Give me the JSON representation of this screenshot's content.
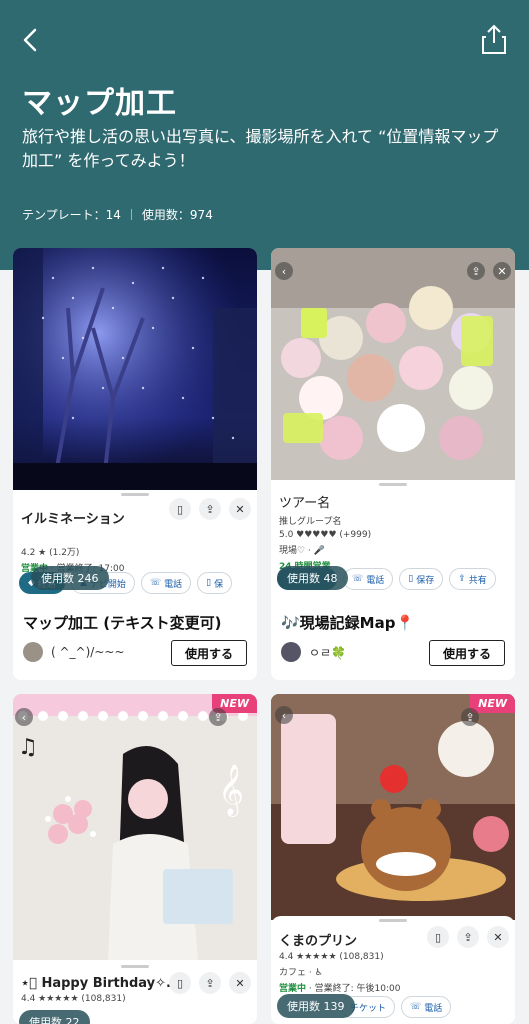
{
  "header": {
    "title": "マップ加工",
    "description": "旅行や推し活の思い出写真に、撮影場所を入れて “位置情報マップ加工” を作ってみよう！",
    "templates_label": "テンプレート：14",
    "usage_label": "使用数：974"
  },
  "cards": [
    {
      "place_name": "イルミネーション",
      "rating": "4.2 ★ (1.2万)",
      "status": "営業中",
      "status_rest": " · 営業終了: 17:00",
      "chips": [
        "経路",
        "ナビ開始",
        "電話",
        "保"
      ],
      "usage": "使用数 246",
      "title": "マップ加工 (テキスト変更可)",
      "author": "( ^_^)/~~~",
      "button": "使用する"
    },
    {
      "place_name": "ツアー名",
      "group": "推しグループ名",
      "rating": "5.0 ♥♥♥♥♥ (+999)",
      "place_line": "現場♡ · 🎤",
      "status": "24 時間営業",
      "chips": [
        "",
        "電話",
        "保存",
        "共有"
      ],
      "usage": "使用数 48",
      "title": "🎶現場記録Map📍",
      "author": "ㅇㄹ🍀",
      "button": "使用する"
    },
    {
      "new": "NEW",
      "place_name": "⋆͛ Happy Birthday✧.*",
      "rating": "4.4 ★★★★★ (108,831)",
      "usage": "使用数 22"
    },
    {
      "new": "NEW",
      "place_name": "くまのプリン",
      "rating": "4.4 ★★★★★ (108,831)",
      "category": "カフェ · ♿",
      "status": "営業中",
      "status_rest": " · 営業終了: 午後10:00",
      "chips": [
        "チケット",
        "電話"
      ],
      "usage": "使用数 139"
    }
  ],
  "colors": {
    "header_bg": "#2f6a71",
    "accent": "#1f6b86",
    "new_badge": "#e8417a",
    "open_green": "#1e8e3e"
  },
  "icons": [
    "back-arrow-icon",
    "share-icon",
    "bookmark-icon",
    "close-icon",
    "navigation-icon",
    "phone-icon"
  ]
}
